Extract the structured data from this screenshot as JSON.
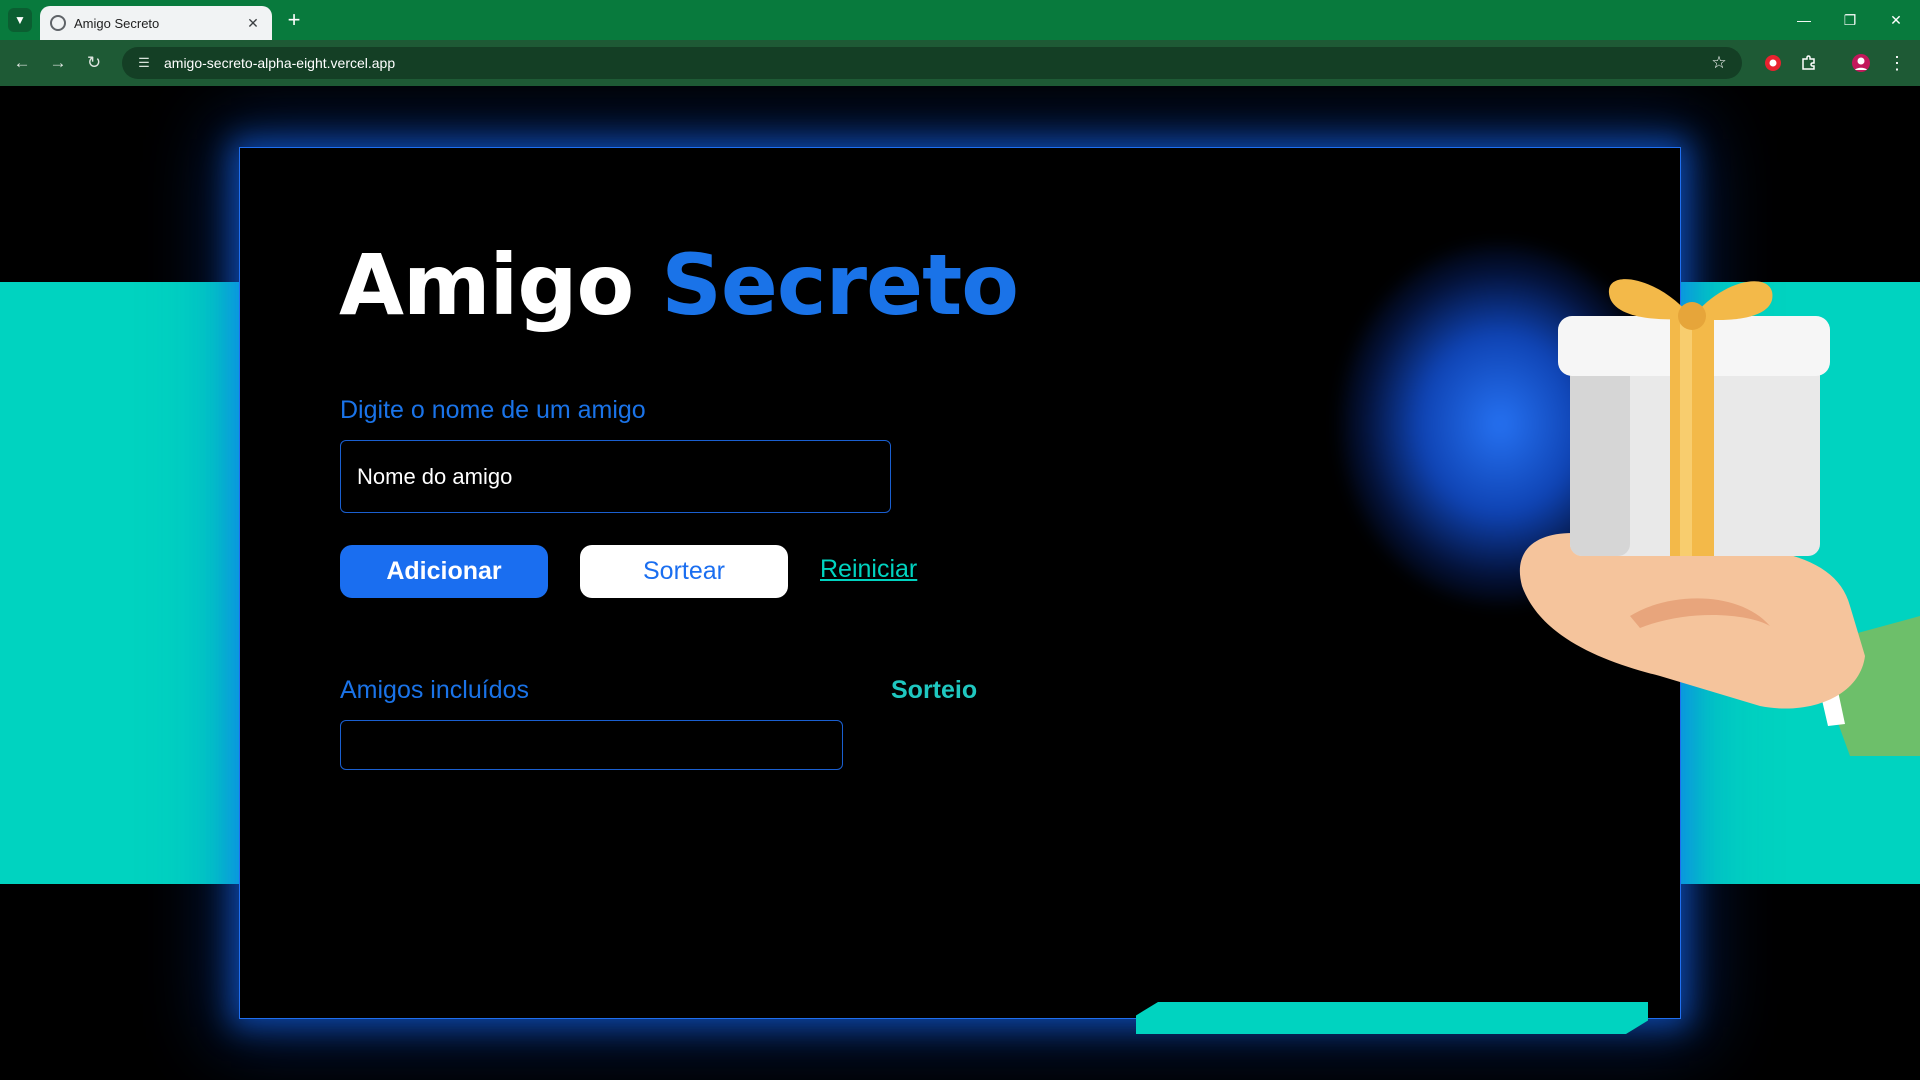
{
  "browser": {
    "tab_title": "Amigo Secreto",
    "url": "amigo-secreto-alpha-eight.vercel.app",
    "icons": {
      "tab_menu": "chevron-down-icon",
      "favicon": "globe-icon",
      "tab_close": "close-icon",
      "new_tab": "plus-icon",
      "back": "arrow-left-icon",
      "forward": "arrow-right-icon",
      "reload": "reload-icon",
      "site_info": "tune-icon",
      "bookmark": "star-icon",
      "extension_red": "red-extension-icon",
      "extensions": "puzzle-icon",
      "profile": "profile-avatar-icon",
      "more": "more-vert-icon",
      "minimize": "minimize-icon",
      "restore": "restore-icon",
      "close_window": "close-window-icon"
    },
    "colors": {
      "tabbar": "#087a3d",
      "toolbar": "#1e5a35"
    }
  },
  "page": {
    "title_part1": "Amigo",
    "title_part2": "Secreto",
    "input_label": "Digite o nome de um amigo",
    "input_placeholder": "Nome do amigo",
    "input_value": "",
    "add_button": "Adicionar",
    "draw_button": "Sortear",
    "reset_link": "Reiniciar",
    "list_label": "Amigos incluídos",
    "result_label": "Sorteio",
    "friends": [],
    "illustration": "gift-on-hand-illustration",
    "colors": {
      "accent_blue": "#1a73e8",
      "teal": "#00d3c0",
      "background": "#000000"
    }
  }
}
